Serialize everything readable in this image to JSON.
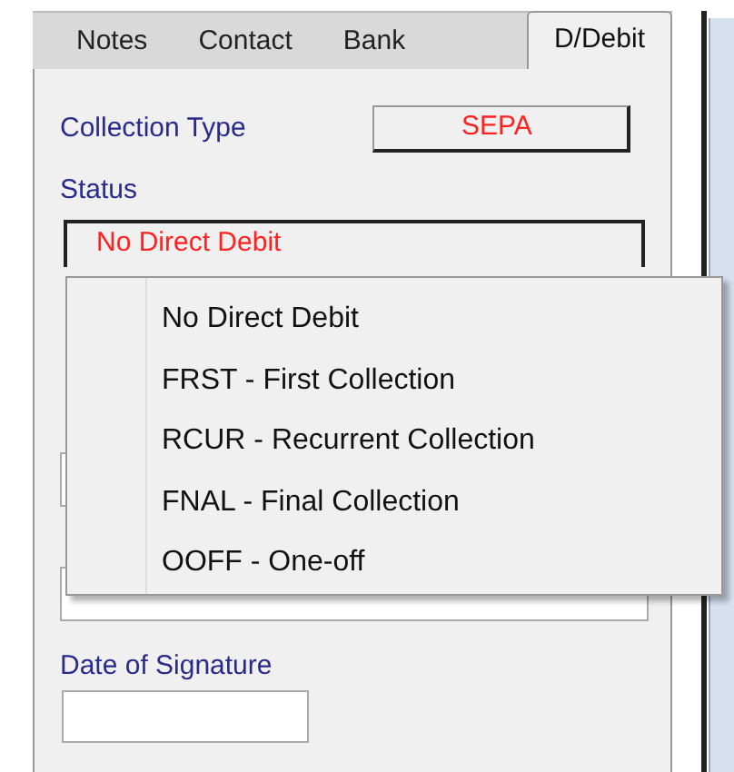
{
  "tabs": [
    {
      "label": "Notes",
      "selected": false
    },
    {
      "label": "Contact",
      "selected": false
    },
    {
      "label": "Bank",
      "selected": false
    },
    {
      "label": "D/Debit",
      "selected": true
    }
  ],
  "collection_type": {
    "label": "Collection Type",
    "value": "SEPA"
  },
  "status": {
    "label": "Status",
    "value": "No Direct Debit"
  },
  "status_menu": {
    "items": [
      "No Direct Debit",
      "FRST - First Collection",
      "RCUR - Recurrent Collection",
      "FNAL - Final Collection",
      "OOFF - One-off"
    ]
  },
  "date_of_signature": {
    "label": "Date of Signature"
  }
}
